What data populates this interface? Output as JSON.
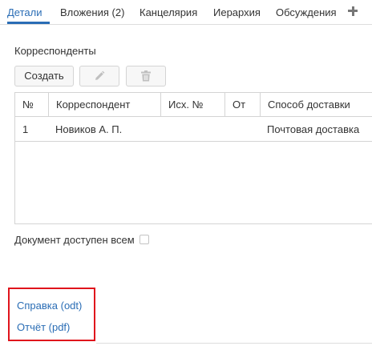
{
  "tabs": [
    {
      "label": "Детали",
      "active": true
    },
    {
      "label": "Вложения (2)",
      "active": false
    },
    {
      "label": "Канцелярия",
      "active": false
    },
    {
      "label": "Иерархия",
      "active": false
    },
    {
      "label": "Обсуждения",
      "active": false
    }
  ],
  "add_tab_icon": "plus-icon",
  "correspondents": {
    "title": "Корреспонденты",
    "create_label": "Создать",
    "edit_icon": "pencil-icon",
    "delete_icon": "trash-icon",
    "columns": [
      "№",
      "Корреспондент",
      "Исх. №",
      "От",
      "Способ доставки"
    ],
    "rows": [
      {
        "num": "1",
        "name": "Новиков А. П.",
        "out_num": "",
        "from": "",
        "delivery": "Почтовая доставка"
      }
    ]
  },
  "public_access": {
    "label": "Документ доступен всем",
    "checked": false
  },
  "attachments": [
    {
      "label": "Справка (odt)"
    },
    {
      "label": "Отчёт (pdf)"
    }
  ],
  "colors": {
    "accent": "#2a6db5",
    "highlight": "#e0141c",
    "border": "#d4d4d4"
  }
}
